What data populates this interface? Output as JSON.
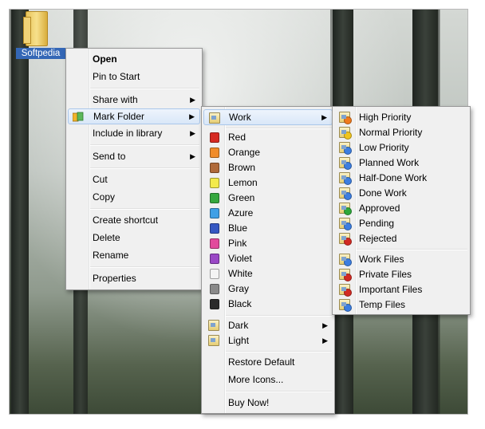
{
  "desktop": {
    "icon_label": "Softpedia"
  },
  "context_menu": {
    "open": "Open",
    "pin_to_start": "Pin to Start",
    "share_with": "Share with",
    "mark_folder": "Mark Folder",
    "include_in_library": "Include in library",
    "send_to": "Send to",
    "cut": "Cut",
    "copy": "Copy",
    "create_shortcut": "Create shortcut",
    "delete": "Delete",
    "rename": "Rename",
    "properties": "Properties"
  },
  "mark_folder_menu": {
    "work": "Work",
    "colors": [
      {
        "label": "Red",
        "color": "#d62a22"
      },
      {
        "label": "Orange",
        "color": "#f08c2a"
      },
      {
        "label": "Brown",
        "color": "#b06a3a"
      },
      {
        "label": "Lemon",
        "color": "#f3ea4a"
      },
      {
        "label": "Green",
        "color": "#35a83e"
      },
      {
        "label": "Azure",
        "color": "#3fa0e6"
      },
      {
        "label": "Blue",
        "color": "#3557c2"
      },
      {
        "label": "Pink",
        "color": "#e24a9c"
      },
      {
        "label": "Violet",
        "color": "#9a48c6"
      },
      {
        "label": "White",
        "color": "#f4f4f4"
      },
      {
        "label": "Gray",
        "color": "#8a8a8a"
      },
      {
        "label": "Black",
        "color": "#2b2b2b"
      }
    ],
    "dark": "Dark",
    "light": "Light",
    "restore_default": "Restore Default",
    "more_icons": "More Icons...",
    "buy_now": "Buy Now!"
  },
  "work_menu": {
    "items": [
      {
        "label": "High Priority",
        "badge": "#f07a1c"
      },
      {
        "label": "Normal Priority",
        "badge": "#f0c41c"
      },
      {
        "label": "Low Priority",
        "badge": "#3c7ee0"
      },
      {
        "label": "Planned Work",
        "badge": "#3c7ee0"
      },
      {
        "label": "Half-Done Work",
        "badge": "#3c7ee0"
      },
      {
        "label": "Done Work",
        "badge": "#3c7ee0"
      },
      {
        "label": "Approved",
        "badge": "#2ea83a"
      },
      {
        "label": "Pending",
        "badge": "#3c7ee0"
      },
      {
        "label": "Rejected",
        "badge": "#d22a22"
      }
    ],
    "files": [
      {
        "label": "Work Files",
        "badge": "#3c7ee0"
      },
      {
        "label": "Private Files",
        "badge": "#d22a22"
      },
      {
        "label": "Important Files",
        "badge": "#d22a22"
      },
      {
        "label": "Temp Files",
        "badge": "#3c7ee0"
      }
    ]
  }
}
